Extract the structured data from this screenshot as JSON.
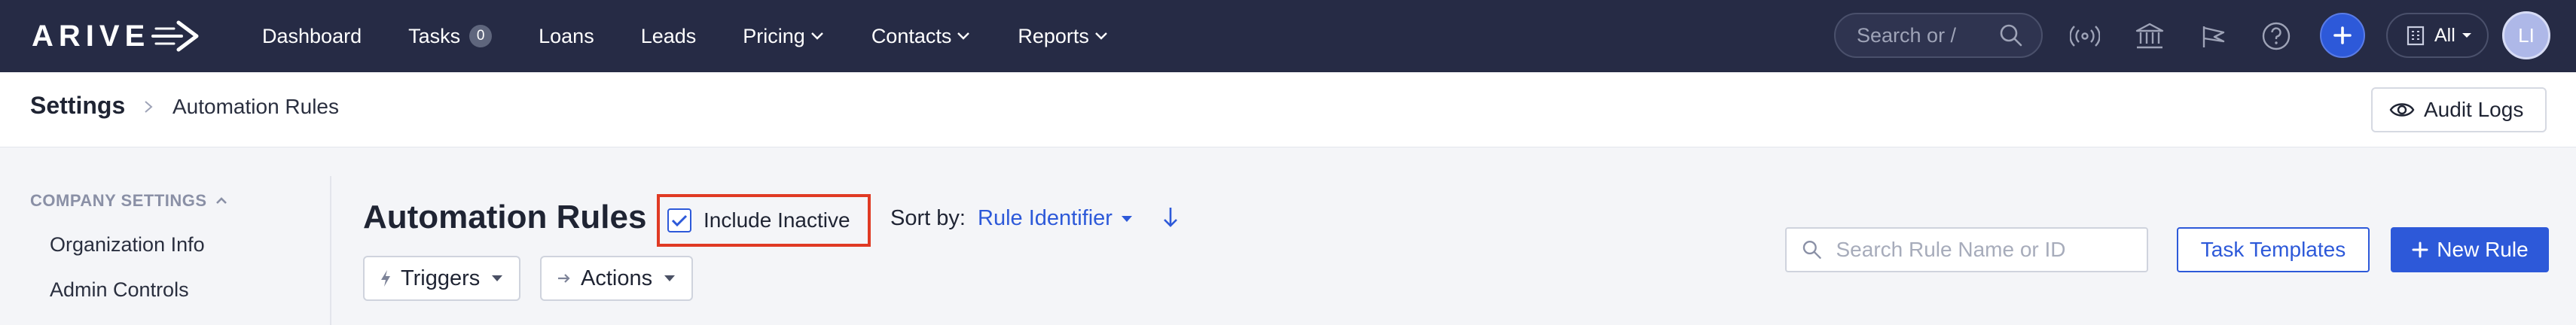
{
  "app": {
    "logo_text": "ARIVE"
  },
  "nav": {
    "items": [
      {
        "label": "Dashboard"
      },
      {
        "label": "Tasks",
        "badge": "0"
      },
      {
        "label": "Loans"
      },
      {
        "label": "Leads"
      },
      {
        "label": "Pricing",
        "dropdown": true
      },
      {
        "label": "Contacts",
        "dropdown": true
      },
      {
        "label": "Reports",
        "dropdown": true
      }
    ],
    "search_placeholder": "Search or /",
    "icons": [
      "broadcast-icon",
      "bank-icon",
      "announcement-icon",
      "help-icon"
    ],
    "scope_label": "All",
    "avatar_initials": "LI"
  },
  "breadcrumb": {
    "root": "Settings",
    "current": "Automation Rules",
    "audit_logs_label": "Audit Logs"
  },
  "sidebar": {
    "section_label": "COMPANY SETTINGS",
    "items": [
      {
        "label": "Organization Info"
      },
      {
        "label": "Admin Controls"
      }
    ]
  },
  "main": {
    "title": "Automation Rules",
    "include_inactive_label": "Include Inactive",
    "include_inactive_checked": true,
    "sort_label": "Sort by:",
    "sort_value": "Rule Identifier",
    "sort_direction": "descending",
    "triggers_label": "Triggers",
    "actions_label": "Actions",
    "search_placeholder": "Search Rule Name or ID",
    "task_templates_label": "Task Templates",
    "new_rule_label": "New Rule"
  },
  "colors": {
    "nav_bg": "#262b45",
    "accent": "#2d59d9",
    "highlight_border": "#e03a24"
  }
}
